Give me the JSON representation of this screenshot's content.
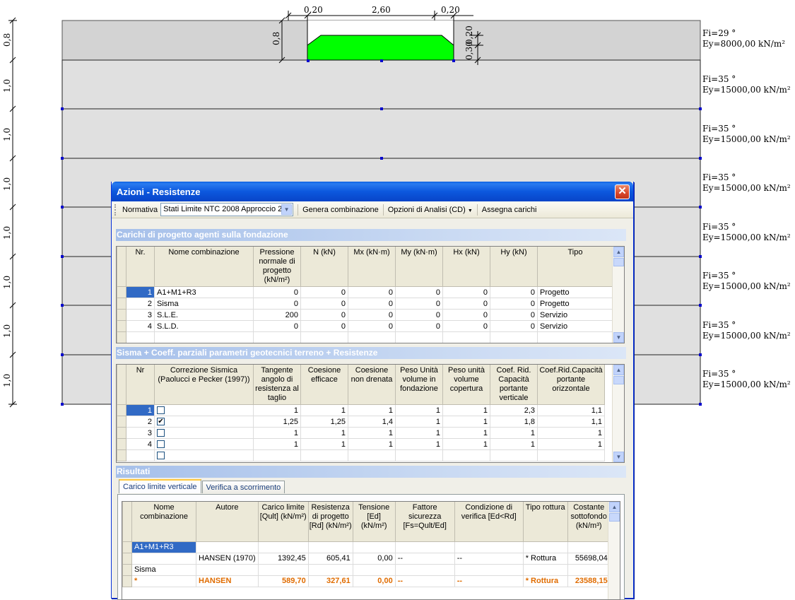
{
  "drawing": {
    "top_dims": [
      "0,20",
      "2,60",
      "0,20"
    ],
    "footing_dims": {
      "left_height": "0,8",
      "right_height": "0,30",
      "right_top": "0,20"
    },
    "left_dims": [
      "0,8",
      "1,0",
      "1,0",
      "1,0",
      "1,0",
      "1,0",
      "1,0",
      "1,0"
    ],
    "layers": [
      {
        "phi": "Fi=29 °",
        "ey": "Ey=8000,00 kN/m²"
      },
      {
        "phi": "Fi=35 °",
        "ey": "Ey=15000,00 kN/m²"
      },
      {
        "phi": "Fi=35 °",
        "ey": "Ey=15000,00 kN/m²"
      },
      {
        "phi": "Fi=35 °",
        "ey": "Ey=15000,00 kN/m²"
      },
      {
        "phi": "Fi=35 °",
        "ey": "Ey=15000,00 kN/m²"
      },
      {
        "phi": "Fi=35 °",
        "ey": "Ey=15000,00 kN/m²"
      },
      {
        "phi": "Fi=35 °",
        "ey": "Ey=15000,00 kN/m²"
      },
      {
        "phi": "Fi=35 °",
        "ey": "Ey=15000,00 kN/m²"
      }
    ],
    "colors": {
      "top_layer": "#d3d3d3",
      "layer": "#e0e0e0",
      "footing": "#00ff00"
    }
  },
  "dialog": {
    "title": "Azioni - Resistenze",
    "close_glyph": "✕",
    "toolbar": {
      "normativa_label": "Normativa",
      "normativa_value": "Stati Limite NTC 2008 Approccio 2",
      "genera_label": "Genera combinazione",
      "opzioni_label": "Opzioni di Analisi (CD)",
      "assegna_label": "Assegna carichi"
    },
    "section1_title": "Carichi di progetto agenti sulla fondazione",
    "loads": {
      "headers": [
        "Nr.",
        "Nome combinazione",
        "Pressione normale di progetto (kN/m²)",
        "N (kN)",
        "Mx (kN·m)",
        "My (kN·m)",
        "Hx (kN)",
        "Hy (kN)",
        "Tipo"
      ],
      "rows": [
        [
          "1",
          "A1+M1+R3",
          "0",
          "0",
          "0",
          "0",
          "0",
          "0",
          "Progetto"
        ],
        [
          "2",
          "Sisma",
          "0",
          "0",
          "0",
          "0",
          "0",
          "0",
          "Progetto"
        ],
        [
          "3",
          "S.L.E.",
          "200",
          "0",
          "0",
          "0",
          "0",
          "0",
          "Servizio"
        ],
        [
          "4",
          "S.L.D.",
          "0",
          "0",
          "0",
          "0",
          "0",
          "0",
          "Servizio"
        ]
      ]
    },
    "section2_title": "Sisma + Coeff. parziali parametri geotecnici terreno + Resistenze",
    "coeffs": {
      "headers": [
        "Nr",
        "Correzione Sismica (Paolucci e Pecker (1997))",
        "Tangente angolo di resistenza al taglio",
        "Coesione efficace",
        "Coesione non drenata",
        "Peso Unità volume in fondazione",
        "Peso unità volume copertura",
        "Coef. Rid. Capacità portante verticale",
        "Coef.Rid.Capacità portante orizzontale"
      ],
      "rows": [
        {
          "nr": "1",
          "checked": false,
          "vals": [
            "1",
            "1",
            "1",
            "1",
            "1",
            "2,3",
            "1,1"
          ]
        },
        {
          "nr": "2",
          "checked": true,
          "vals": [
            "1,25",
            "1,25",
            "1,4",
            "1",
            "1",
            "1,8",
            "1,1"
          ]
        },
        {
          "nr": "3",
          "checked": false,
          "vals": [
            "1",
            "1",
            "1",
            "1",
            "1",
            "1",
            "1"
          ]
        },
        {
          "nr": "4",
          "checked": false,
          "vals": [
            "1",
            "1",
            "1",
            "1",
            "1",
            "1",
            "1"
          ]
        }
      ]
    },
    "section3_title": "Risultati",
    "tabs": [
      "Carico limite verticale",
      "Verifica a scorrimento"
    ],
    "results": {
      "headers": [
        "Nome combinazione",
        "Autore",
        "Carico limite [Qult] (kN/m²)",
        "Resistenza di progetto [Rd] (kN/m²)",
        "Tensione [Ed] (kN/m²)",
        "Fattore sicurezza [Fs=Qult/Ed]",
        "Condizione di verifica [Ed<Rd]",
        "Tipo rottura",
        "Costante sottofondo (kN/m³)"
      ],
      "group1": "A1+M1+R3",
      "row1": [
        "",
        "HANSEN (1970)",
        "1392,45",
        "605,41",
        "0,00",
        "--",
        "--",
        "*  Rottura",
        "55698,04"
      ],
      "group2": "Sisma",
      "row2": [
        "*",
        "HANSEN",
        "589,70",
        "327,61",
        "0,00",
        "--",
        "--",
        "*  Rottura",
        "23588,15"
      ]
    }
  }
}
